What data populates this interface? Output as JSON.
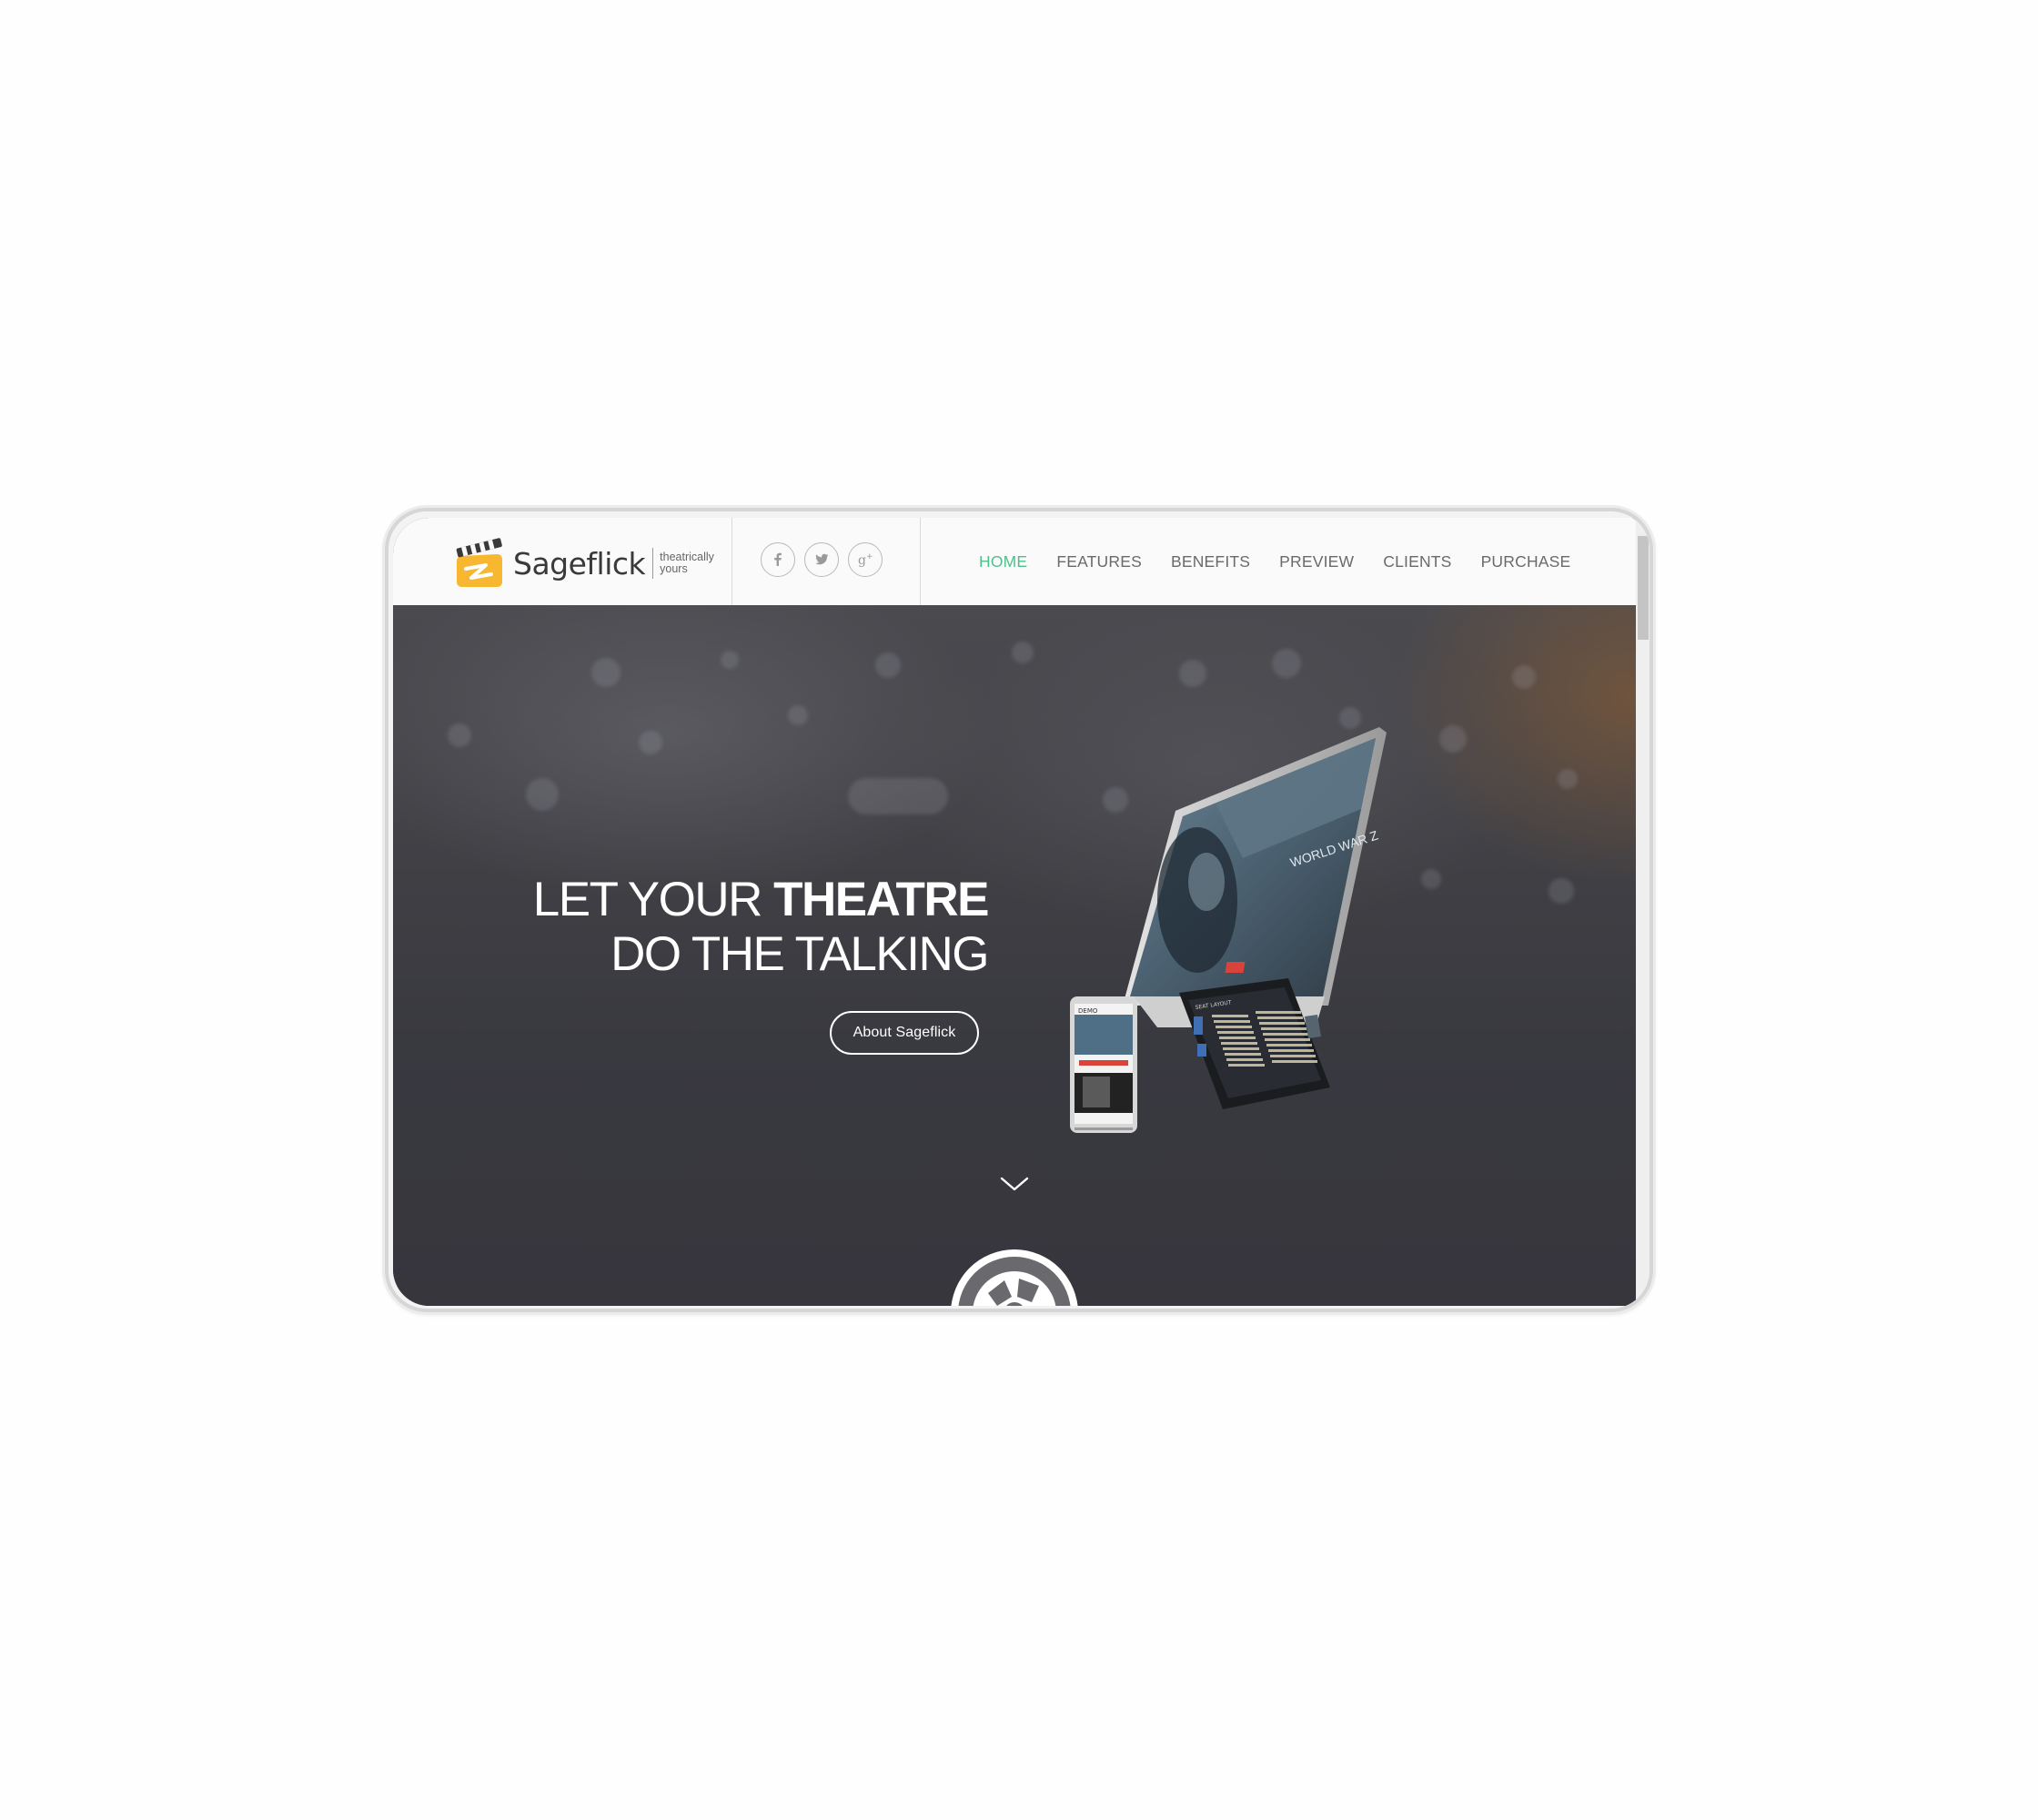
{
  "brand": {
    "name": "Sageflick",
    "tagline_line1": "theatrically",
    "tagline_line2": "yours",
    "logo_colors": {
      "mark": "#f7b731",
      "ink": "#3a3a3a"
    }
  },
  "social": [
    {
      "icon": "facebook-icon",
      "glyph": "f"
    },
    {
      "icon": "twitter-icon",
      "glyph": "bird"
    },
    {
      "icon": "google-plus-icon",
      "glyph": "g+"
    }
  ],
  "nav": {
    "items": [
      {
        "label": "HOME",
        "active": true
      },
      {
        "label": "FEATURES",
        "active": false
      },
      {
        "label": "BENEFITS",
        "active": false
      },
      {
        "label": "PREVIEW",
        "active": false
      },
      {
        "label": "CLIENTS",
        "active": false
      },
      {
        "label": "PURCHASE",
        "active": false
      }
    ],
    "active_color": "#4fc08d"
  },
  "hero": {
    "line1_normal": "LET YOUR ",
    "line1_bold": "THEATRE",
    "line2": "DO THE TALKING",
    "button_label": "About Sageflick",
    "scroll_icon": "chevron-down-icon"
  },
  "mockup": {
    "desktop_heading": "WORLD WAR Z",
    "mobile_caption": "DEMO",
    "tablet_title": "SEAT LAYOUT"
  }
}
